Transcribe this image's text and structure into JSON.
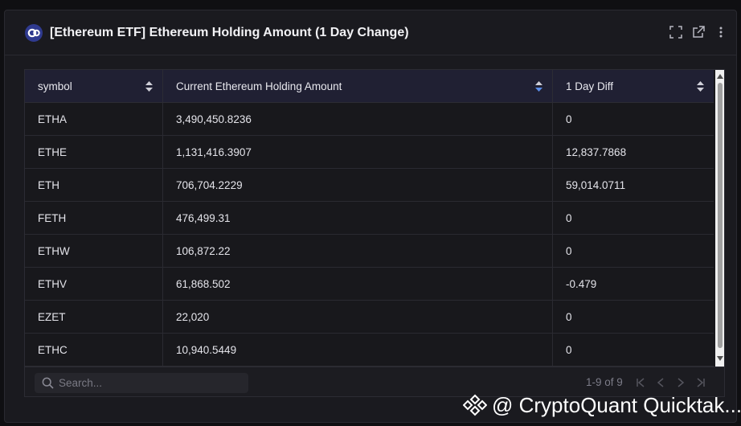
{
  "panel": {
    "title": "[Ethereum ETF] Ethereum Holding Amount (1 Day Change)",
    "header_icons": [
      "fullscreen-icon",
      "external-link-icon",
      "more-vertical-icon"
    ]
  },
  "table": {
    "columns": [
      {
        "label": "symbol"
      },
      {
        "label": "Current Ethereum Holding Amount"
      },
      {
        "label": "1 Day Diff"
      }
    ],
    "rows": [
      {
        "symbol": "ETHA",
        "amount": "3,490,450.8236",
        "diff": "0"
      },
      {
        "symbol": "ETHE",
        "amount": "1,131,416.3907",
        "diff": "12,837.7868"
      },
      {
        "symbol": "ETH",
        "amount": "706,704.2229",
        "diff": "59,014.0711"
      },
      {
        "symbol": "FETH",
        "amount": "476,499.31",
        "diff": "0"
      },
      {
        "symbol": "ETHW",
        "amount": "106,872.22",
        "diff": "0"
      },
      {
        "symbol": "ETHV",
        "amount": "61,868.502",
        "diff": "-0.479"
      },
      {
        "symbol": "EZET",
        "amount": "22,020",
        "diff": "0"
      },
      {
        "symbol": "ETHC",
        "amount": "10,940.5449",
        "diff": "0"
      }
    ]
  },
  "footer": {
    "search_placeholder": "Search...",
    "pagination": "1-9 of 9"
  },
  "watermark": {
    "text": "@ CryptoQuant Quicktak..."
  },
  "colors": {
    "accent": "#2f3a8f",
    "header_bg": "#202033",
    "panel_bg": "#1a1a1f"
  }
}
